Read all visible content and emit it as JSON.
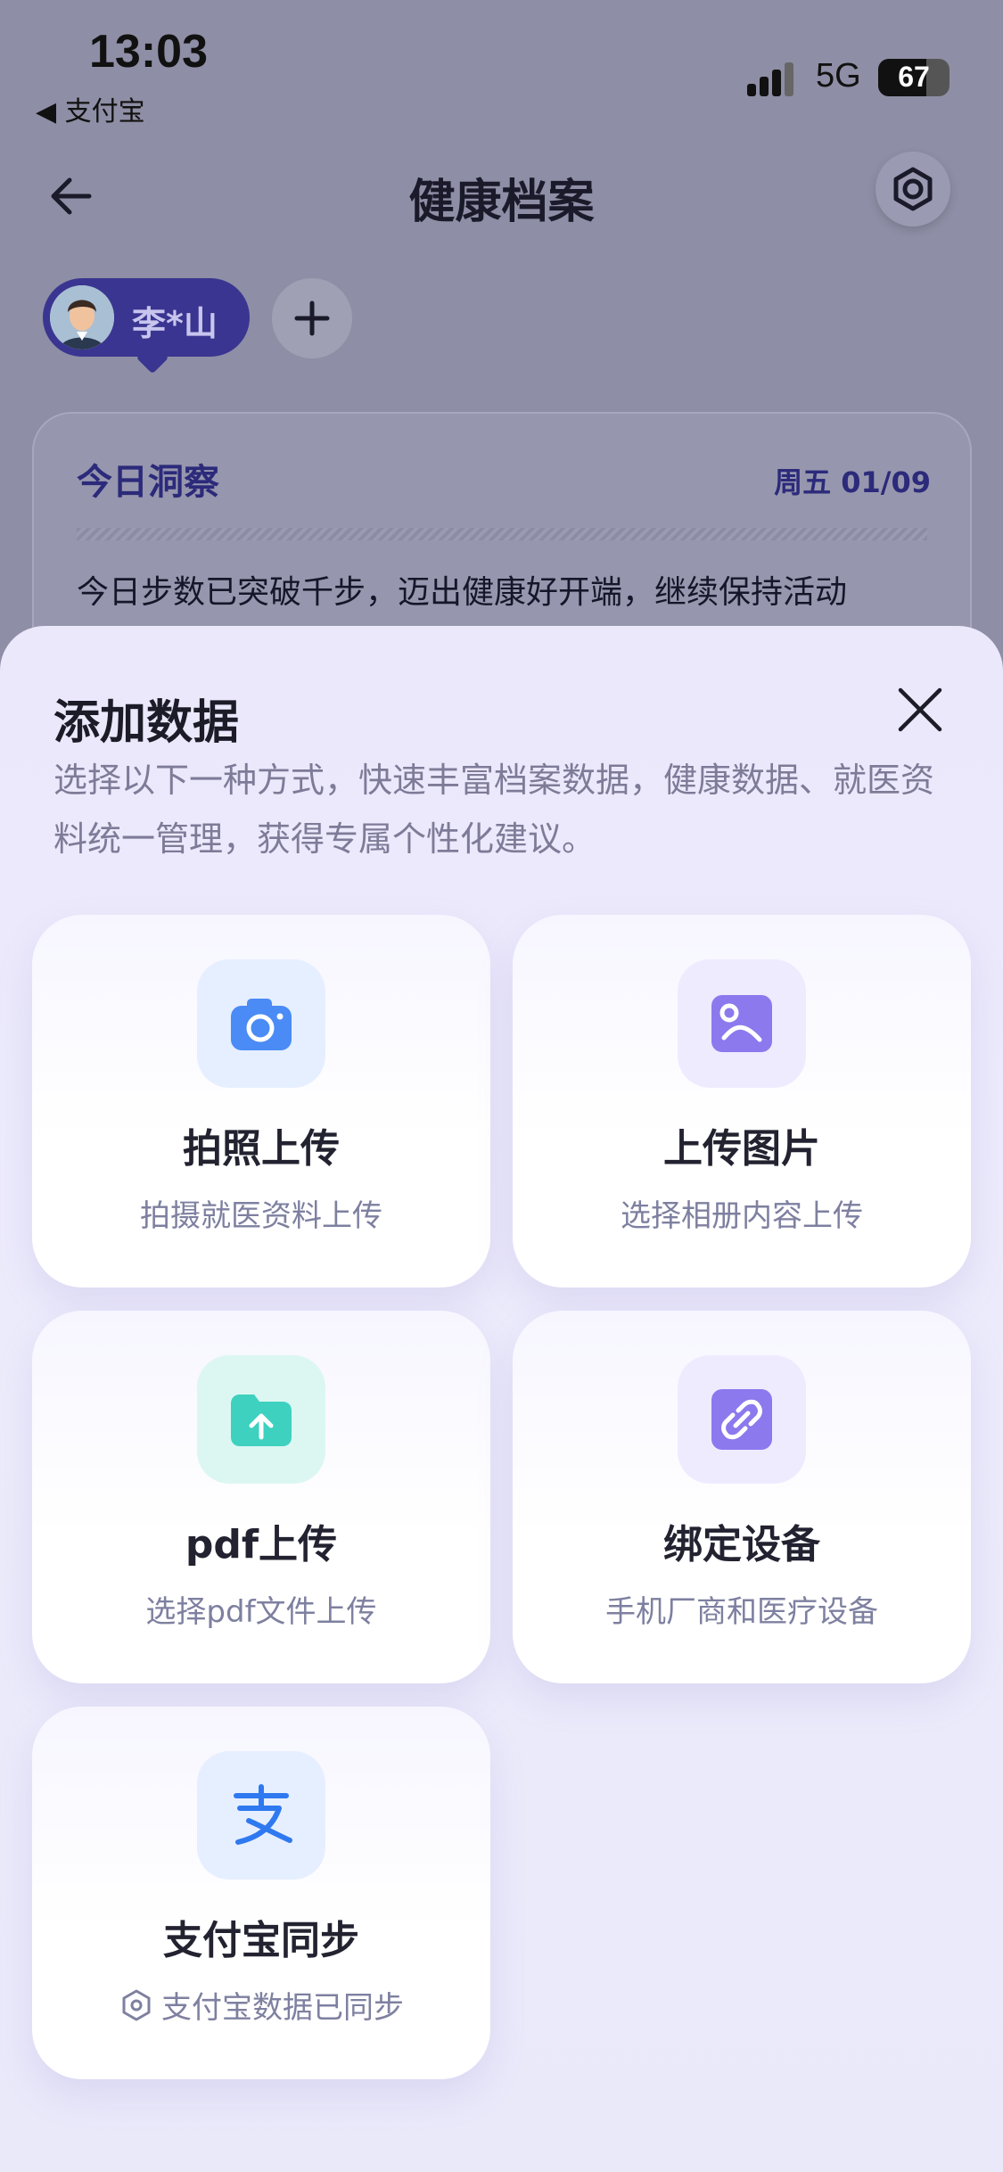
{
  "status_bar": {
    "time": "13:03",
    "back_app": "◀ 支付宝",
    "network": "5G",
    "battery": "67",
    "battery_level": 0.67
  },
  "header": {
    "title": "健康档案"
  },
  "profile": {
    "name": "李*山"
  },
  "insight": {
    "title": "今日洞察",
    "date": "周五 01/09",
    "text": "今日步数已突破千步，迈出健康好开端，继续保持活动"
  },
  "sheet": {
    "title": "添加数据",
    "description": "选择以下一种方式，快速丰富档案数据，健康数据、就医资料统一管理，获得专属个性化建议。",
    "options": [
      {
        "title": "拍照上传",
        "subtitle": "拍摄就医资料上传",
        "icon": "camera-icon",
        "color": "#4a8bf5"
      },
      {
        "title": "上传图片",
        "subtitle": "选择相册内容上传",
        "icon": "image-icon",
        "color": "#8c79ee"
      },
      {
        "title": "pdf上传",
        "subtitle": "选择pdf文件上传",
        "icon": "folder-upload-icon",
        "color": "#3ed1bf"
      },
      {
        "title": "绑定设备",
        "subtitle": "手机厂商和医疗设备",
        "icon": "link-icon",
        "color": "#8c79ee"
      },
      {
        "title": "支付宝同步",
        "subtitle": "支付宝数据已同步",
        "icon": "alipay-icon",
        "color": "#2f79f0"
      }
    ]
  }
}
